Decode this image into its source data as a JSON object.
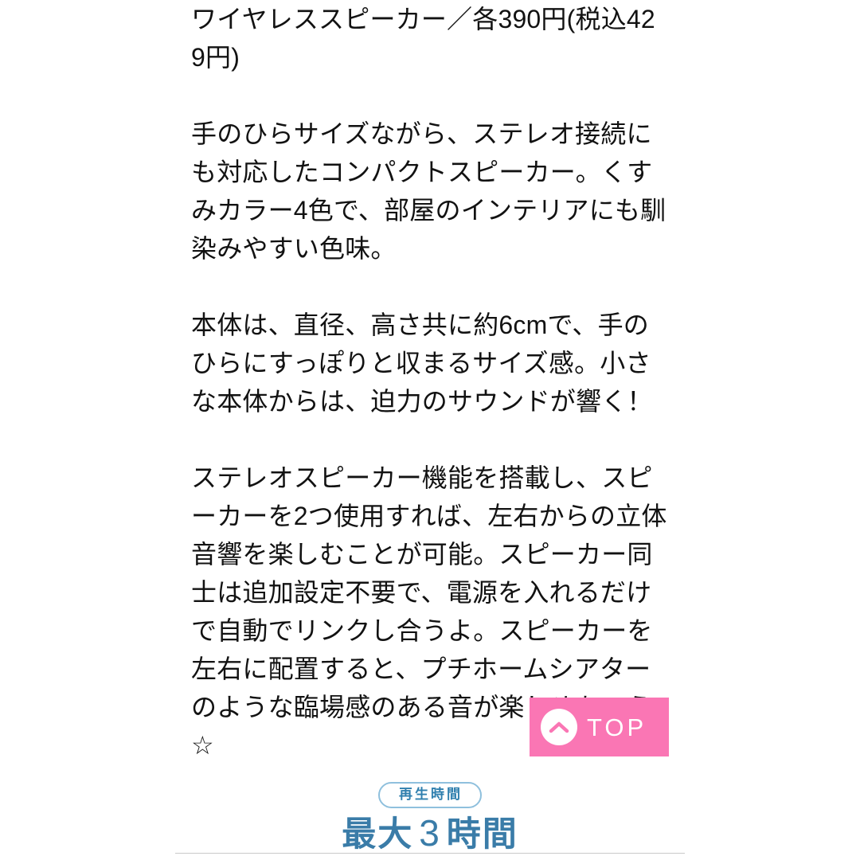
{
  "article": {
    "paragraphs": [
      "ワイヤレススピーカー／各390円(税込429円)",
      "手のひらサイズながら、ステレオ接続にも対応したコンパクトスピーカー。くすみカラー4色で、部屋のインテリアにも馴染みやすい色味。",
      "本体は、直径、高さ共に約6cmで、手のひらにすっぽりと収まるサイズ感。小さな本体からは、迫力のサウンドが響く！",
      "ステレオスピーカー機能を搭載し、スピーカーを2つ使用すれば、左右からの立体音響を楽しむことが可能。スピーカー同士は追加設定不要で、電源を入れるだけで自動でリンクし合うよ。スピーカーを左右に配置すると、プチホームシアターのような臨場感のある音が楽しめちゃう☆"
    ]
  },
  "top_button": {
    "label": "TOP",
    "icon": "chevron-up-icon",
    "background_color": "#fa76b4",
    "label_color": "#ffffff"
  },
  "spec": {
    "badge_label": "再生時間",
    "value_prefix": "最大",
    "value_number": "3",
    "value_suffix": "時間",
    "accent_color": "#3a7ca8",
    "badge_border_color": "#8fc0dd"
  }
}
